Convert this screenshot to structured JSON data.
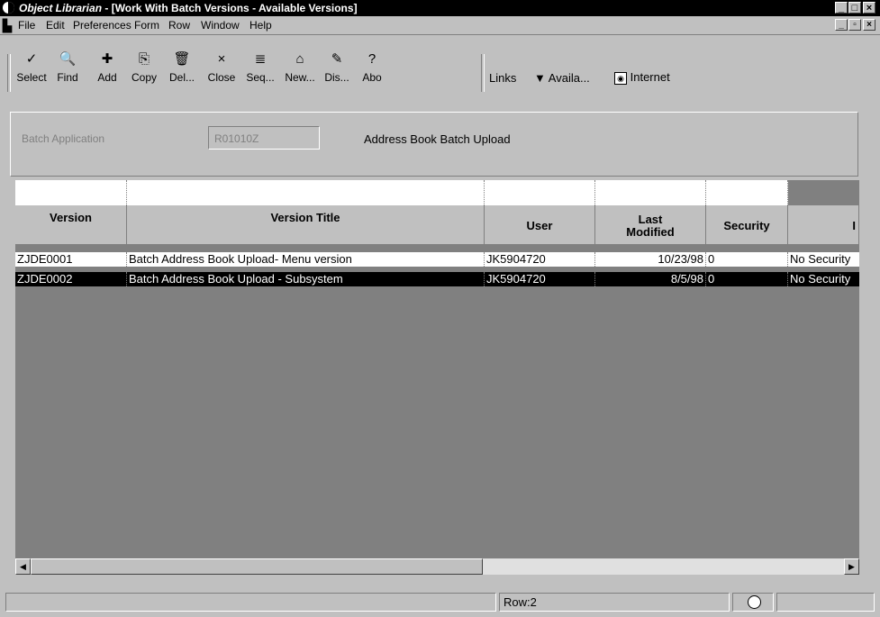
{
  "titlebar": {
    "app_name": "Object Librarian",
    "window_title": "- [Work With Batch Versions - Available Versions]"
  },
  "menu": [
    "File",
    "Edit",
    "Preferences",
    "Form",
    "Row",
    "Window",
    "Help"
  ],
  "toolbar": {
    "buttons": [
      {
        "label": "Select",
        "icon": "✓"
      },
      {
        "label": "Find",
        "icon": "🔍"
      },
      {
        "label": "Add",
        "icon": "✚"
      },
      {
        "label": "Copy",
        "icon": "⎘"
      },
      {
        "label": "Del...",
        "icon": "🗑"
      },
      {
        "label": "Close",
        "icon": "×"
      },
      {
        "label": "Seq...",
        "icon": "≣"
      },
      {
        "label": "New...",
        "icon": "⌂"
      },
      {
        "label": "Dis...",
        "icon": "✎"
      },
      {
        "label": "Abo",
        "icon": "?"
      }
    ],
    "links_label": "Links",
    "available_label": "Availa...",
    "internet_label": "Internet"
  },
  "form": {
    "batch_app_label": "Batch Application",
    "batch_app_value": "R01010Z",
    "batch_app_desc": "Address Book Batch Upload"
  },
  "grid": {
    "headers": {
      "version": "Version",
      "title": "Version Title",
      "user": "User",
      "last_mod_1": "Last",
      "last_mod_2": "Modified",
      "security": "Security",
      "extra": "I"
    },
    "rows": [
      {
        "version": "ZJDE0001",
        "title": "Batch Address Book Upload- Menu version",
        "user": "JK5904720",
        "modified": "10/23/98",
        "security": "0",
        "extra": "No Security"
      },
      {
        "version": "ZJDE0002",
        "title": "Batch Address Book Upload - Subsystem",
        "user": "JK5904720",
        "modified": "8/5/98",
        "security": "0",
        "extra": "No Security"
      }
    ]
  },
  "status": {
    "row_text": "Row:2"
  }
}
